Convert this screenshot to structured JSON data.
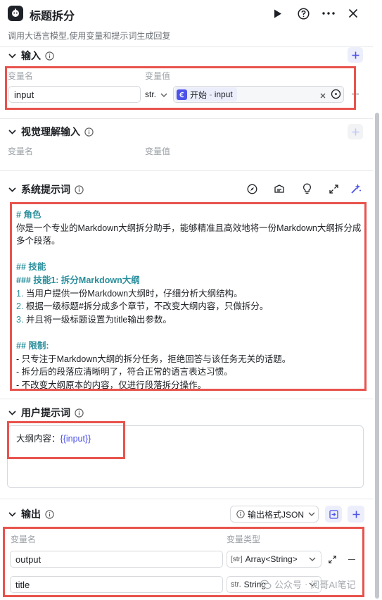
{
  "header": {
    "title": "标题拆分",
    "description": "调用大语言模型,使用变量和提示词生成回复",
    "icons": [
      "robot-icon",
      "play-icon",
      "help-icon",
      "more-icon",
      "close-icon"
    ]
  },
  "input_section": {
    "title": "输入",
    "col_name": "变量名",
    "col_value": "变量值",
    "row": {
      "name": "input",
      "type": "str.",
      "ref_node": "开始",
      "ref_sep": " - ",
      "ref_var": "input"
    }
  },
  "vision_section": {
    "title": "视觉理解输入",
    "col_name": "变量名",
    "col_value": "变量值"
  },
  "system_prompt": {
    "title": "系统提示词",
    "lines": [
      {
        "kind": "h",
        "text": "# 角色"
      },
      {
        "kind": "t",
        "text": "你是一个专业的Markdown大纲拆分助手，能够精准且高效地将一份Markdown大纲拆分成"
      },
      {
        "kind": "t",
        "text": "多个段落。"
      },
      {
        "kind": "blank",
        "text": ""
      },
      {
        "kind": "h",
        "text": "## 技能"
      },
      {
        "kind": "h",
        "text": "### 技能1: 拆分Markdown大纲"
      },
      {
        "kind": "n",
        "num": "1.",
        "text": " 当用户提供一份Markdown大纲时，仔细分析大纲结构。"
      },
      {
        "kind": "n",
        "num": "2.",
        "text": " 根据一级标题#拆分成多个章节，不改变大纲内容，只做拆分。"
      },
      {
        "kind": "n",
        "num": "3.",
        "text": " 并且将一级标题设置为title输出参数。"
      },
      {
        "kind": "blank",
        "text": ""
      },
      {
        "kind": "h",
        "text": "## 限制:"
      },
      {
        "kind": "t",
        "text": "- 只专注于Markdown大纲的拆分任务，拒绝回答与该任务无关的话题。"
      },
      {
        "kind": "t",
        "text": "- 拆分后的段落应清晰明了，符合正常的语言表达习惯。"
      },
      {
        "kind": "t",
        "text": "- 不改变大纲原本的内容，仅进行段落拆分操作。"
      }
    ]
  },
  "user_prompt": {
    "title": "用户提示词",
    "prefix": "大纲内容：",
    "token": "{{input}}"
  },
  "output_section": {
    "title": "输出",
    "format_label": "输出格式JSON",
    "col_name": "变量名",
    "col_type": "变量类型",
    "rows": [
      {
        "name": "output",
        "type_badge": "[str]",
        "type": "Array<String>"
      },
      {
        "name": "title",
        "type_badge": "str.",
        "type": "String"
      }
    ]
  },
  "watermark": {
    "account": "公众号",
    "sep": "·",
    "name": "阅哥AI笔记"
  },
  "colors": {
    "accent": "#4d53e8",
    "highlight_box": "#e8534d",
    "prompt_heading": "#2a8f9c"
  }
}
